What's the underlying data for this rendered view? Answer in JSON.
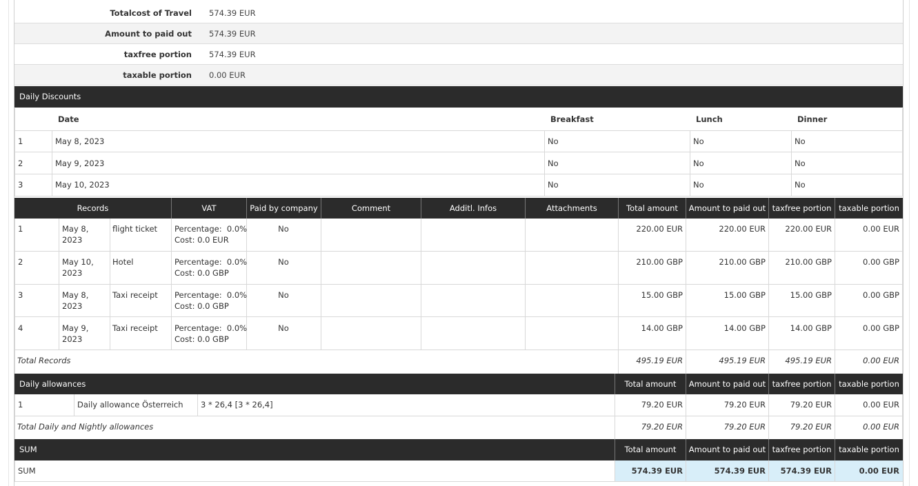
{
  "summary": [
    {
      "label": "Totalcost of Travel",
      "value": "574.39 EUR"
    },
    {
      "label": "Amount to paid out",
      "value": "574.39 EUR"
    },
    {
      "label": "taxfree portion",
      "value": "574.39 EUR"
    },
    {
      "label": "taxable portion",
      "value": "0.00 EUR"
    }
  ],
  "daily_discounts": {
    "title": "Daily Discounts",
    "headers": {
      "date": "Date",
      "breakfast": "Breakfast",
      "lunch": "Lunch",
      "dinner": "Dinner"
    },
    "rows": [
      {
        "n": "1",
        "date": "May 8, 2023",
        "breakfast": "No",
        "lunch": "No",
        "dinner": "No"
      },
      {
        "n": "2",
        "date": "May 9, 2023",
        "breakfast": "No",
        "lunch": "No",
        "dinner": "No"
      },
      {
        "n": "3",
        "date": "May 10, 2023",
        "breakfast": "No",
        "lunch": "No",
        "dinner": "No"
      }
    ]
  },
  "records": {
    "headers": {
      "records": "Records",
      "vat": "VAT",
      "paid_by_company": "Paid by company",
      "comment": "Comment",
      "additl_infos": "Additl. Infos",
      "attachments": "Attachments",
      "total_amount": "Total amount",
      "amount_paid_out": "Amount to paid out",
      "taxfree": "taxfree portion",
      "taxable": "taxable portion"
    },
    "rows": [
      {
        "n": "1",
        "date_l1": "May 8,",
        "date_l2": "2023",
        "desc": "flight ticket",
        "vat_pct": "Percentage:  0.0%",
        "vat_cost": "Cost: 0.0 EUR",
        "paid": "No",
        "total": "220.00 EUR",
        "paid_out": "220.00 EUR",
        "taxfree": "220.00 EUR",
        "taxable": "0.00 EUR"
      },
      {
        "n": "2",
        "date_l1": "May 10,",
        "date_l2": "2023",
        "desc": "Hotel",
        "vat_pct": "Percentage:  0.0%",
        "vat_cost": "Cost: 0.0 GBP",
        "paid": "No",
        "total": "210.00 GBP",
        "paid_out": "210.00 GBP",
        "taxfree": "210.00 GBP",
        "taxable": "0.00 GBP"
      },
      {
        "n": "3",
        "date_l1": "May 8,",
        "date_l2": "2023",
        "desc": "Taxi receipt",
        "vat_pct": "Percentage:  0.0%",
        "vat_cost": "Cost: 0.0 GBP",
        "paid": "No",
        "total": "15.00 GBP",
        "paid_out": "15.00 GBP",
        "taxfree": "15.00 GBP",
        "taxable": "0.00 GBP"
      },
      {
        "n": "4",
        "date_l1": "May 9,",
        "date_l2": "2023",
        "desc": "Taxi receipt",
        "vat_pct": "Percentage:  0.0%",
        "vat_cost": "Cost: 0.0 GBP",
        "paid": "No",
        "total": "14.00 GBP",
        "paid_out": "14.00 GBP",
        "taxfree": "14.00 GBP",
        "taxable": "0.00 GBP"
      }
    ],
    "total": {
      "label": "Total Records",
      "total": "495.19 EUR",
      "paid_out": "495.19 EUR",
      "taxfree": "495.19 EUR",
      "taxable": "0.00 EUR"
    }
  },
  "allowances": {
    "title": "Daily allowances",
    "headers": {
      "total_amount": "Total amount",
      "amount_paid_out": "Amount to paid out",
      "taxfree": "taxfree portion",
      "taxable": "taxable portion"
    },
    "row": {
      "n": "1",
      "name": "Daily allowance Österreich",
      "calc": "3 * 26,4 [3 * 26,4]",
      "total": "79.20 EUR",
      "paid_out": "79.20 EUR",
      "taxfree": "79.20 EUR",
      "taxable": "0.00 EUR"
    },
    "total": {
      "label": "Total Daily and Nightly allowances",
      "total": "79.20 EUR",
      "paid_out": "79.20 EUR",
      "taxfree": "79.20 EUR",
      "taxable": "0.00 EUR"
    }
  },
  "sum": {
    "title": "SUM",
    "headers": {
      "total_amount": "Total amount",
      "amount_paid_out": "Amount to paid out",
      "taxfree": "taxfree portion",
      "taxable": "taxable portion"
    },
    "row": {
      "label": "SUM",
      "total": "574.39 EUR",
      "paid_out": "574.39 EUR",
      "taxfree": "574.39 EUR",
      "taxable": "0.00 EUR"
    }
  },
  "colors": {
    "header_bg": "#2b2b2b",
    "sum_highlight": "#d8eef9",
    "row_alt": "#f3f3f3"
  }
}
